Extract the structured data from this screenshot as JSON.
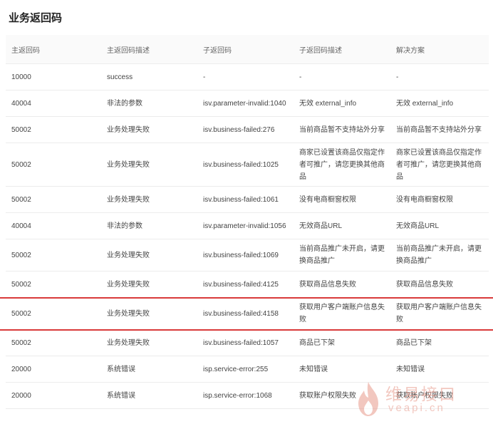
{
  "page_title": "业务返回码",
  "columns": [
    "主返回码",
    "主返回码描述",
    "子返回码",
    "子返回码描述",
    "解决方案"
  ],
  "rows": [
    {
      "code": "10000",
      "desc": "success",
      "sub_code": "-",
      "sub_desc": "-",
      "solution": "-"
    },
    {
      "code": "40004",
      "desc": "非法的参数",
      "sub_code": "isv.parameter-invalid:1040",
      "sub_desc": "无效 external_info",
      "solution": "无效 external_info"
    },
    {
      "code": "50002",
      "desc": "业务处理失败",
      "sub_code": "isv.business-failed:276",
      "sub_desc": "当前商品暂不支持站外分享",
      "solution": "当前商品暂不支持站外分享"
    },
    {
      "code": "50002",
      "desc": "业务处理失败",
      "sub_code": "isv.business-failed:1025",
      "sub_desc": "商家已设置该商品仅指定作者可推广，请您更换其他商品",
      "solution": "商家已设置该商品仅指定作者可推广，请您更换其他商品"
    },
    {
      "code": "50002",
      "desc": "业务处理失败",
      "sub_code": "isv.business-failed:1061",
      "sub_desc": "没有电商橱窗权限",
      "solution": "没有电商橱窗权限"
    },
    {
      "code": "40004",
      "desc": "非法的参数",
      "sub_code": "isv.parameter-invalid:1056",
      "sub_desc": "无效商品URL",
      "solution": "无效商品URL"
    },
    {
      "code": "50002",
      "desc": "业务处理失败",
      "sub_code": "isv.business-failed:1069",
      "sub_desc": "当前商品推广未开启，请更换商品推广",
      "solution": "当前商品推广未开启，请更换商品推广"
    },
    {
      "code": "50002",
      "desc": "业务处理失败",
      "sub_code": "isv.business-failed:4125",
      "sub_desc": "获取商品信息失败",
      "solution": "获取商品信息失败"
    },
    {
      "code": "50002",
      "desc": "业务处理失败",
      "sub_code": "isv.business-failed:4158",
      "sub_desc": "获取用户客户端账户信息失败",
      "solution": "获取用户客户端账户信息失败"
    },
    {
      "code": "50002",
      "desc": "业务处理失败",
      "sub_code": "isv.business-failed:1057",
      "sub_desc": "商品已下架",
      "solution": "商品已下架"
    },
    {
      "code": "20000",
      "desc": "系统错误",
      "sub_code": "isp.service-error:255",
      "sub_desc": "未知错误",
      "solution": "未知错误"
    },
    {
      "code": "20000",
      "desc": "系统错误",
      "sub_code": "isp.service-error:1068",
      "sub_desc": "获取账户权限失败",
      "solution": "获取账户权限失败"
    }
  ],
  "watermark": {
    "brand": "维易接口",
    "domain": "veapi.cn",
    "accent": "#e89a8c"
  },
  "highlight_color": "#d93a3a"
}
